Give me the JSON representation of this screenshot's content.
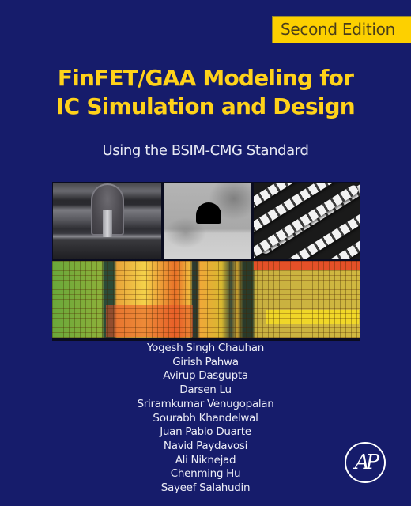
{
  "cover": {
    "background_color": "#161c6b",
    "accent_color": "#ffd21a",
    "edition_badge": "Second Edition",
    "title_line1": "FinFET/GAA Modeling for",
    "title_line2": "IC Simulation and Design",
    "subtitle": "Using the BSIM-CMG Standard",
    "images": [
      {
        "name": "finfet-sem-image",
        "description": "SEM cross-section of FinFET gate"
      },
      {
        "name": "gaa-tem-image",
        "description": "TEM image of gate-all-around nanowire"
      },
      {
        "name": "nanosheet-array-image",
        "description": "SEM of nanosheet array"
      },
      {
        "name": "chip-die-image",
        "description": "IC die micrograph"
      }
    ],
    "authors": [
      "Yogesh Singh Chauhan",
      "Girish Pahwa",
      "Avirup Dasgupta",
      "Darsen Lu",
      "Sriramkumar Venugopalan",
      "Sourabh Khandelwal",
      "Juan Pablo Duarte",
      "Navid Paydavosi",
      "Ali Niknejad",
      "Chenming Hu",
      "Sayeef Salahudin"
    ],
    "publisher_logo": "AP"
  }
}
